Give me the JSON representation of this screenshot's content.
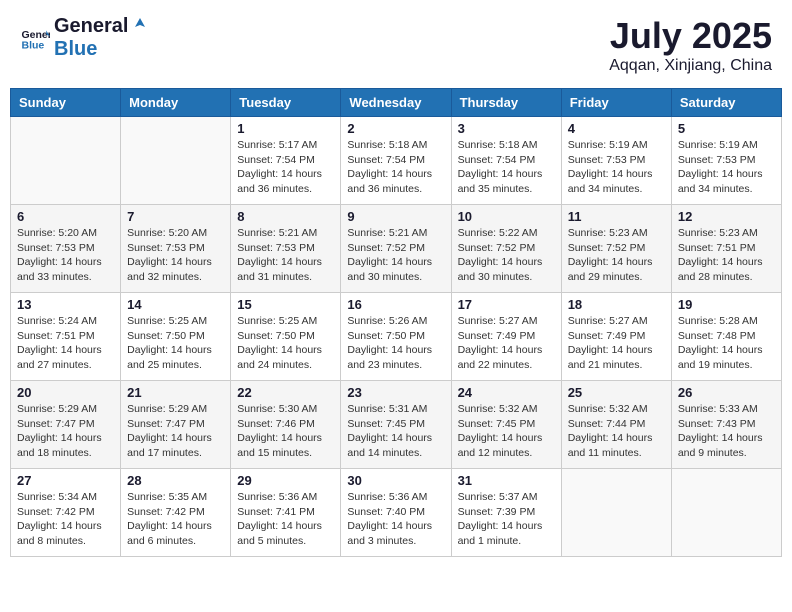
{
  "header": {
    "logo_general": "General",
    "logo_blue": "Blue",
    "month_year": "July 2025",
    "location": "Aqqan, Xinjiang, China"
  },
  "weekdays": [
    "Sunday",
    "Monday",
    "Tuesday",
    "Wednesday",
    "Thursday",
    "Friday",
    "Saturday"
  ],
  "weeks": [
    [
      {
        "day": "",
        "sunrise": "",
        "sunset": "",
        "daylight": ""
      },
      {
        "day": "",
        "sunrise": "",
        "sunset": "",
        "daylight": ""
      },
      {
        "day": "1",
        "sunrise": "Sunrise: 5:17 AM",
        "sunset": "Sunset: 7:54 PM",
        "daylight": "Daylight: 14 hours and 36 minutes."
      },
      {
        "day": "2",
        "sunrise": "Sunrise: 5:18 AM",
        "sunset": "Sunset: 7:54 PM",
        "daylight": "Daylight: 14 hours and 36 minutes."
      },
      {
        "day": "3",
        "sunrise": "Sunrise: 5:18 AM",
        "sunset": "Sunset: 7:54 PM",
        "daylight": "Daylight: 14 hours and 35 minutes."
      },
      {
        "day": "4",
        "sunrise": "Sunrise: 5:19 AM",
        "sunset": "Sunset: 7:53 PM",
        "daylight": "Daylight: 14 hours and 34 minutes."
      },
      {
        "day": "5",
        "sunrise": "Sunrise: 5:19 AM",
        "sunset": "Sunset: 7:53 PM",
        "daylight": "Daylight: 14 hours and 34 minutes."
      }
    ],
    [
      {
        "day": "6",
        "sunrise": "Sunrise: 5:20 AM",
        "sunset": "Sunset: 7:53 PM",
        "daylight": "Daylight: 14 hours and 33 minutes."
      },
      {
        "day": "7",
        "sunrise": "Sunrise: 5:20 AM",
        "sunset": "Sunset: 7:53 PM",
        "daylight": "Daylight: 14 hours and 32 minutes."
      },
      {
        "day": "8",
        "sunrise": "Sunrise: 5:21 AM",
        "sunset": "Sunset: 7:53 PM",
        "daylight": "Daylight: 14 hours and 31 minutes."
      },
      {
        "day": "9",
        "sunrise": "Sunrise: 5:21 AM",
        "sunset": "Sunset: 7:52 PM",
        "daylight": "Daylight: 14 hours and 30 minutes."
      },
      {
        "day": "10",
        "sunrise": "Sunrise: 5:22 AM",
        "sunset": "Sunset: 7:52 PM",
        "daylight": "Daylight: 14 hours and 30 minutes."
      },
      {
        "day": "11",
        "sunrise": "Sunrise: 5:23 AM",
        "sunset": "Sunset: 7:52 PM",
        "daylight": "Daylight: 14 hours and 29 minutes."
      },
      {
        "day": "12",
        "sunrise": "Sunrise: 5:23 AM",
        "sunset": "Sunset: 7:51 PM",
        "daylight": "Daylight: 14 hours and 28 minutes."
      }
    ],
    [
      {
        "day": "13",
        "sunrise": "Sunrise: 5:24 AM",
        "sunset": "Sunset: 7:51 PM",
        "daylight": "Daylight: 14 hours and 27 minutes."
      },
      {
        "day": "14",
        "sunrise": "Sunrise: 5:25 AM",
        "sunset": "Sunset: 7:50 PM",
        "daylight": "Daylight: 14 hours and 25 minutes."
      },
      {
        "day": "15",
        "sunrise": "Sunrise: 5:25 AM",
        "sunset": "Sunset: 7:50 PM",
        "daylight": "Daylight: 14 hours and 24 minutes."
      },
      {
        "day": "16",
        "sunrise": "Sunrise: 5:26 AM",
        "sunset": "Sunset: 7:50 PM",
        "daylight": "Daylight: 14 hours and 23 minutes."
      },
      {
        "day": "17",
        "sunrise": "Sunrise: 5:27 AM",
        "sunset": "Sunset: 7:49 PM",
        "daylight": "Daylight: 14 hours and 22 minutes."
      },
      {
        "day": "18",
        "sunrise": "Sunrise: 5:27 AM",
        "sunset": "Sunset: 7:49 PM",
        "daylight": "Daylight: 14 hours and 21 minutes."
      },
      {
        "day": "19",
        "sunrise": "Sunrise: 5:28 AM",
        "sunset": "Sunset: 7:48 PM",
        "daylight": "Daylight: 14 hours and 19 minutes."
      }
    ],
    [
      {
        "day": "20",
        "sunrise": "Sunrise: 5:29 AM",
        "sunset": "Sunset: 7:47 PM",
        "daylight": "Daylight: 14 hours and 18 minutes."
      },
      {
        "day": "21",
        "sunrise": "Sunrise: 5:29 AM",
        "sunset": "Sunset: 7:47 PM",
        "daylight": "Daylight: 14 hours and 17 minutes."
      },
      {
        "day": "22",
        "sunrise": "Sunrise: 5:30 AM",
        "sunset": "Sunset: 7:46 PM",
        "daylight": "Daylight: 14 hours and 15 minutes."
      },
      {
        "day": "23",
        "sunrise": "Sunrise: 5:31 AM",
        "sunset": "Sunset: 7:45 PM",
        "daylight": "Daylight: 14 hours and 14 minutes."
      },
      {
        "day": "24",
        "sunrise": "Sunrise: 5:32 AM",
        "sunset": "Sunset: 7:45 PM",
        "daylight": "Daylight: 14 hours and 12 minutes."
      },
      {
        "day": "25",
        "sunrise": "Sunrise: 5:32 AM",
        "sunset": "Sunset: 7:44 PM",
        "daylight": "Daylight: 14 hours and 11 minutes."
      },
      {
        "day": "26",
        "sunrise": "Sunrise: 5:33 AM",
        "sunset": "Sunset: 7:43 PM",
        "daylight": "Daylight: 14 hours and 9 minutes."
      }
    ],
    [
      {
        "day": "27",
        "sunrise": "Sunrise: 5:34 AM",
        "sunset": "Sunset: 7:42 PM",
        "daylight": "Daylight: 14 hours and 8 minutes."
      },
      {
        "day": "28",
        "sunrise": "Sunrise: 5:35 AM",
        "sunset": "Sunset: 7:42 PM",
        "daylight": "Daylight: 14 hours and 6 minutes."
      },
      {
        "day": "29",
        "sunrise": "Sunrise: 5:36 AM",
        "sunset": "Sunset: 7:41 PM",
        "daylight": "Daylight: 14 hours and 5 minutes."
      },
      {
        "day": "30",
        "sunrise": "Sunrise: 5:36 AM",
        "sunset": "Sunset: 7:40 PM",
        "daylight": "Daylight: 14 hours and 3 minutes."
      },
      {
        "day": "31",
        "sunrise": "Sunrise: 5:37 AM",
        "sunset": "Sunset: 7:39 PM",
        "daylight": "Daylight: 14 hours and 1 minute."
      },
      {
        "day": "",
        "sunrise": "",
        "sunset": "",
        "daylight": ""
      },
      {
        "day": "",
        "sunrise": "",
        "sunset": "",
        "daylight": ""
      }
    ]
  ]
}
